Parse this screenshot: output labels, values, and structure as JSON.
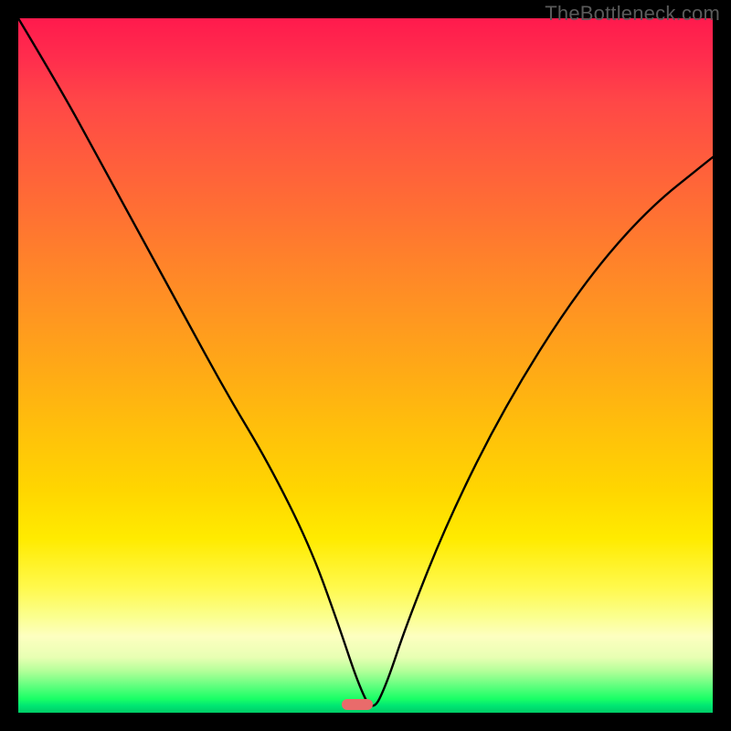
{
  "watermark": "TheBottleneck.com",
  "chart_data": {
    "type": "line",
    "title": "",
    "xlabel": "",
    "ylabel": "",
    "xlim": [
      0,
      100
    ],
    "ylim": [
      0,
      100
    ],
    "grid": false,
    "legend": false,
    "annotations": [
      {
        "kind": "marker",
        "x": 51,
        "y": 0.6,
        "color": "#e96b6b"
      }
    ],
    "series": [
      {
        "name": "curve",
        "color": "#000000",
        "x": [
          0,
          6,
          12,
          18,
          24,
          30,
          36,
          42,
          46,
          49,
          51,
          53,
          56,
          62,
          70,
          80,
          90,
          100
        ],
        "y": [
          100,
          90,
          79,
          68,
          57,
          46,
          36,
          24,
          13,
          4,
          0,
          4,
          13,
          28,
          44,
          60,
          72,
          80
        ]
      }
    ],
    "background_gradient": {
      "top": "#ff1a4d",
      "mid": "#ffeb00",
      "bottom": "#00cc66"
    }
  },
  "marker": {
    "left_pct": 48.8,
    "bottom_pct": 0.4
  }
}
